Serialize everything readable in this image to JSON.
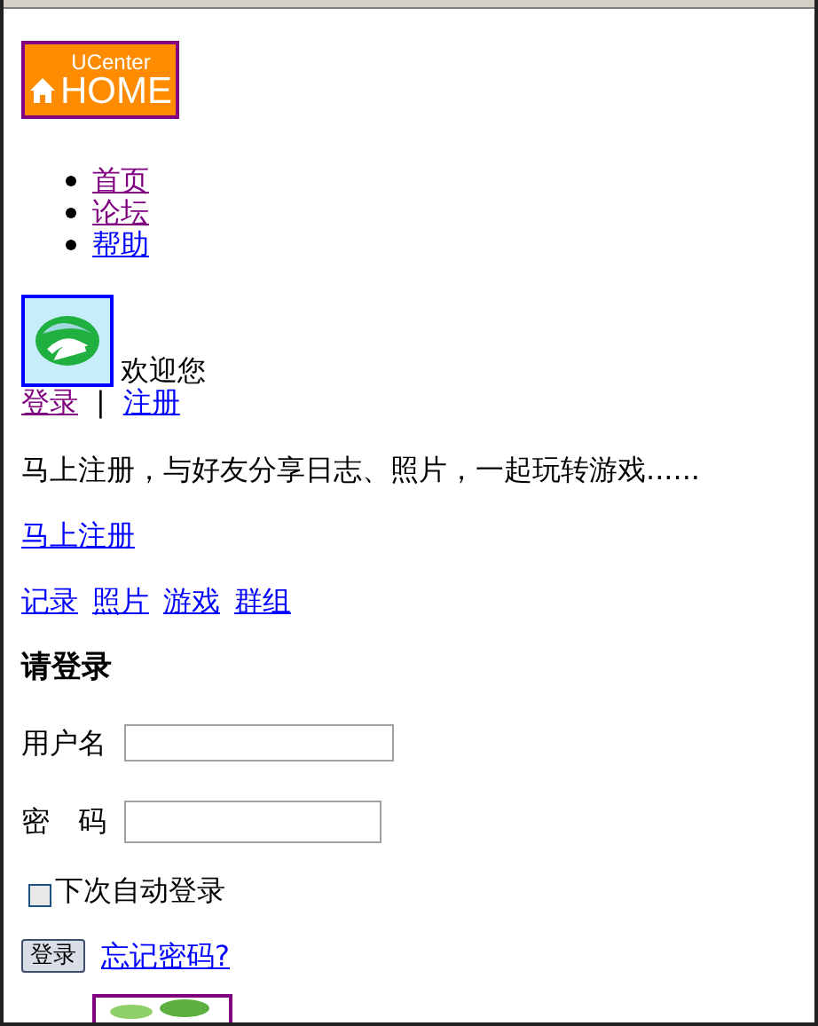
{
  "logo": {
    "line_1": "UCenter",
    "line_2": "HOME"
  },
  "nav": [
    {
      "label": "首页",
      "visited": true
    },
    {
      "label": "论坛",
      "visited": true
    },
    {
      "label": "帮助",
      "visited": false
    }
  ],
  "welcome": "欢迎您",
  "auth_links": [
    {
      "label": "登录",
      "visited": true
    },
    {
      "label": "注册",
      "visited": false
    }
  ],
  "separator": "|",
  "intro": "马上注册，与好友分享日志、照片，一起玩转游戏......",
  "register_link": {
    "label": "马上注册",
    "visited": false
  },
  "feature_links": [
    {
      "label": "记录",
      "visited": false
    },
    {
      "label": "照片",
      "visited": false
    },
    {
      "label": "游戏",
      "visited": false
    },
    {
      "label": "群组",
      "visited": false
    }
  ],
  "login": {
    "heading": "请登录",
    "username_label": "用户名",
    "password_label": "密　码",
    "remember": {
      "label": "下次自动登录",
      "checked": false
    },
    "submit": "登录",
    "forgot": {
      "label": "忘记密码?",
      "visited": false
    }
  }
}
